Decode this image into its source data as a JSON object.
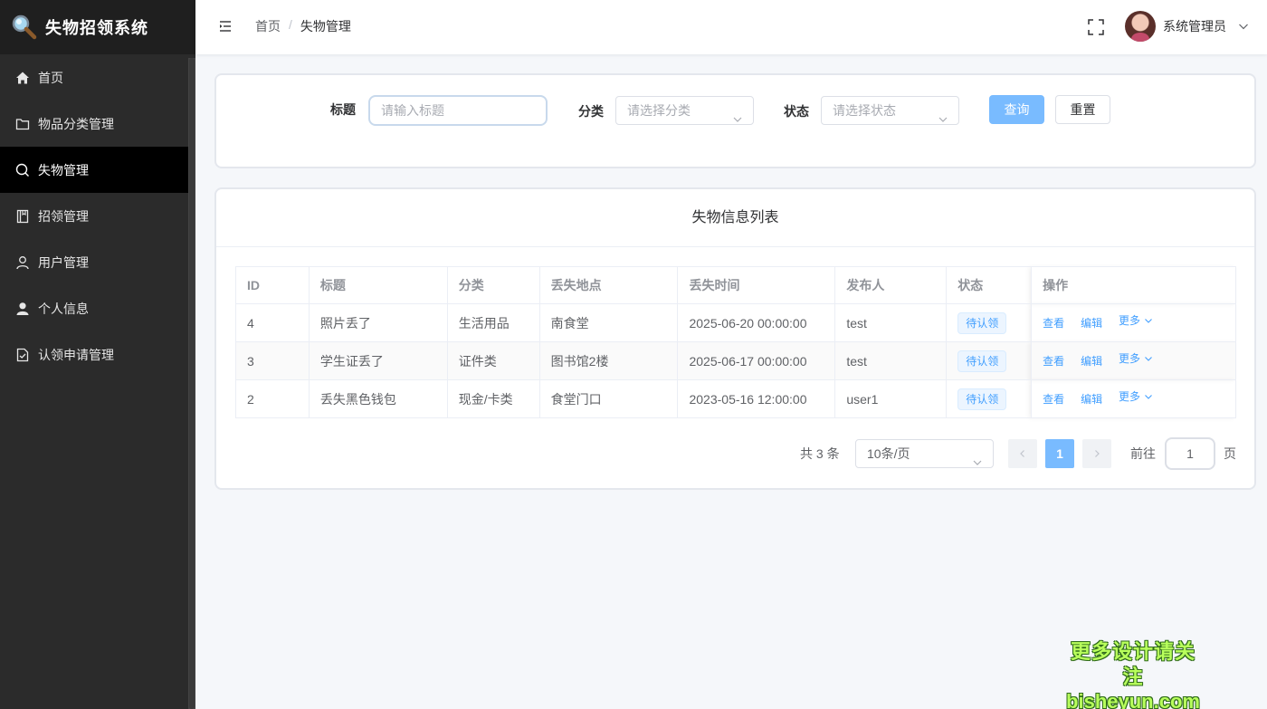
{
  "app": {
    "title": "失物招领系统"
  },
  "sidebar": {
    "items": [
      {
        "label": "首页",
        "icon": "home-icon",
        "active": false
      },
      {
        "label": "物品分类管理",
        "icon": "folder-icon",
        "active": false
      },
      {
        "label": "失物管理",
        "icon": "search-icon",
        "active": true
      },
      {
        "label": "招领管理",
        "icon": "notebook-icon",
        "active": false
      },
      {
        "label": "用户管理",
        "icon": "user-icon",
        "active": false
      },
      {
        "label": "个人信息",
        "icon": "user-filled-icon",
        "active": false
      },
      {
        "label": "认领申请管理",
        "icon": "document-checked-icon",
        "active": false
      }
    ]
  },
  "header": {
    "breadcrumb": [
      "首页",
      "失物管理"
    ],
    "breadcrumb_sep": "/",
    "user_name": "系统管理员"
  },
  "search": {
    "title_label": "标题",
    "title_placeholder": "请输入标题",
    "category_label": "分类",
    "category_placeholder": "请选择分类",
    "status_label": "状态",
    "status_placeholder": "请选择状态",
    "query_button": "查询",
    "reset_button": "重置"
  },
  "list": {
    "title": "失物信息列表",
    "columns": [
      "ID",
      "标题",
      "分类",
      "丢失地点",
      "丢失时间",
      "发布人",
      "状态",
      "操作"
    ],
    "rows": [
      {
        "id": "4",
        "title": "照片丢了",
        "category": "生活用品",
        "location": "南食堂",
        "time": "2025-06-20 00:00:00",
        "publisher": "test",
        "status": "待认领"
      },
      {
        "id": "3",
        "title": "学生证丢了",
        "category": "证件类",
        "location": "图书馆2楼",
        "time": "2025-06-17 00:00:00",
        "publisher": "test",
        "status": "待认领"
      },
      {
        "id": "2",
        "title": "丢失黑色钱包",
        "category": "现金/卡类",
        "location": "食堂门口",
        "time": "2023-05-16 12:00:00",
        "publisher": "user1",
        "status": "待认领"
      }
    ],
    "actions": {
      "view": "查看",
      "edit": "编辑",
      "more": "更多"
    }
  },
  "pagination": {
    "total_text": "共 3 条",
    "page_size": "10条/页",
    "current_page": "1",
    "goto_label": "前往",
    "goto_value": "1",
    "page_suffix": "页"
  },
  "watermark": {
    "line1": "更多设计请关注",
    "line2": "bisheyun.com"
  },
  "colors": {
    "sidebar_bg": "#2b2b2b",
    "active_bg": "#000000",
    "primary": "#409eff",
    "primary_light": "#79bbff",
    "watermark": "#b8ff5c"
  }
}
